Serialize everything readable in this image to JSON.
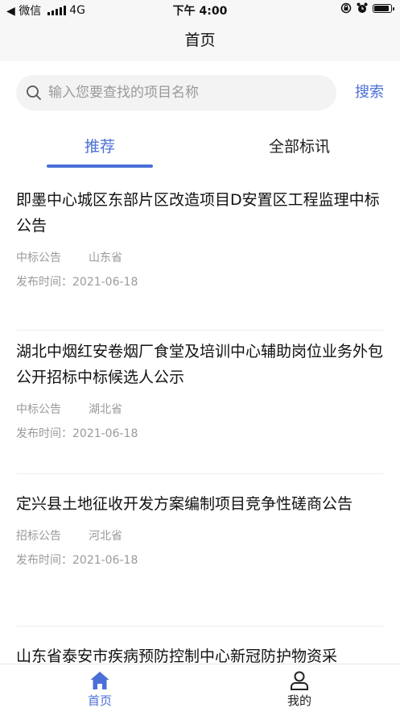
{
  "status_bar": {
    "carrier": "◀ 微信",
    "network": "4G",
    "time": "下午 4:00"
  },
  "nav": {
    "title": "首页"
  },
  "search": {
    "placeholder": "输入您要查找的项目名称",
    "value": "",
    "button_label": "搜索"
  },
  "tabs": [
    {
      "label": "推荐",
      "active": true
    },
    {
      "label": "全部标讯",
      "active": false
    }
  ],
  "items": [
    {
      "title": "即墨中心城区东部片区改造项目D安置区工程监理中标公告",
      "category": "中标公告",
      "region": "山东省",
      "date_label": "发布时间：",
      "date": "2021-06-18"
    },
    {
      "title": "湖北中烟红安卷烟厂食堂及培训中心辅助岗位业务外包公开招标中标候选人公示",
      "category": "中标公告",
      "region": "湖北省",
      "date_label": "发布时间：",
      "date": "2021-06-18"
    },
    {
      "title": "定兴县土地征收开发方案编制项目竞争性磋商公告",
      "category": "招标公告",
      "region": "河北省",
      "date_label": "发布时间：",
      "date": "2021-06-18"
    },
    {
      "title": "山东省泰安市疾病预防控制中心新冠防护物资采",
      "category": "",
      "region": "",
      "date_label": "",
      "date": ""
    }
  ],
  "bottom_nav": [
    {
      "label": "首页",
      "icon": "home-icon",
      "active": true
    },
    {
      "label": "我的",
      "icon": "user-icon",
      "active": false
    }
  ],
  "colors": {
    "accent": "#4a6fd6",
    "muted_text": "#9a9a9a",
    "bar_bg": "#f7f7f7"
  }
}
